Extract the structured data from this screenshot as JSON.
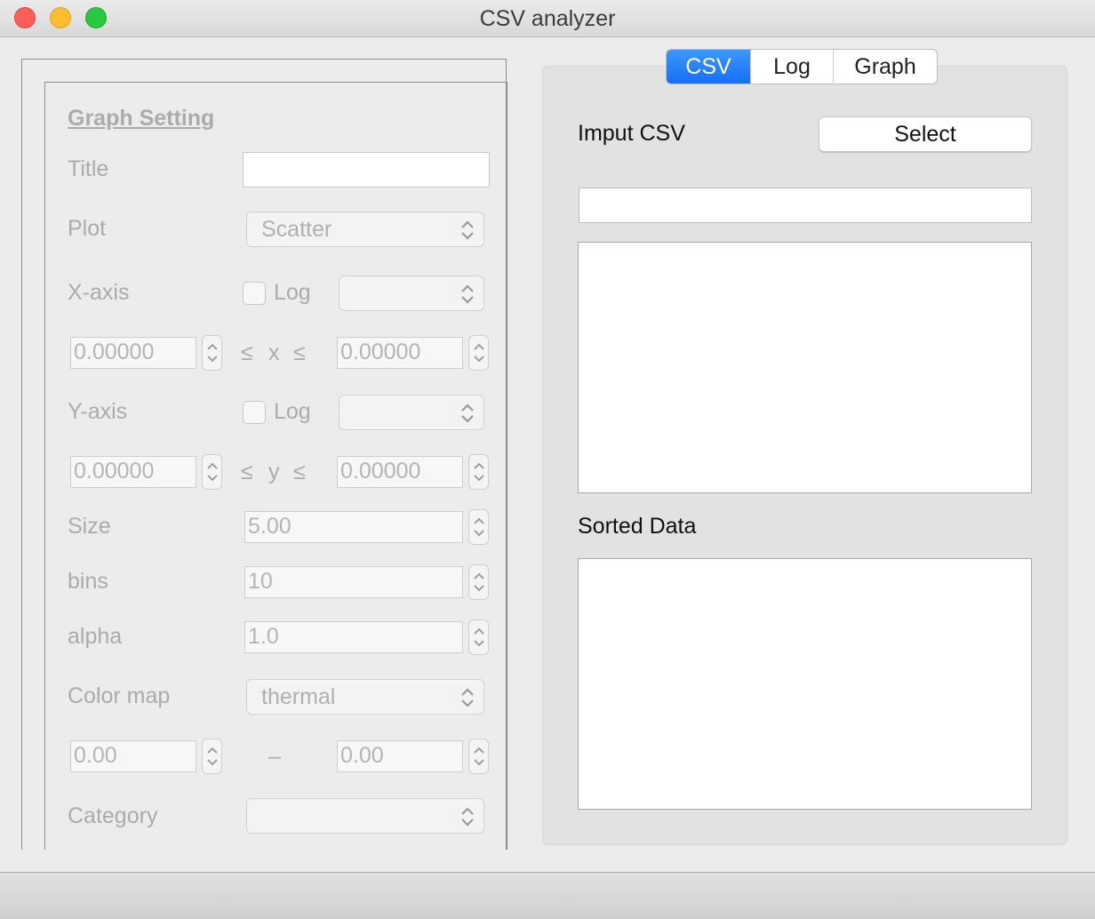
{
  "window": {
    "title": "CSV analyzer"
  },
  "settings": {
    "heading": "Graph Setting",
    "title_label": "Title",
    "title_value": "",
    "plot_label": "Plot",
    "plot_value": "Scatter",
    "xaxis_label": "X-axis",
    "xaxis_log": "Log",
    "x_min": "0.00000",
    "x_max": "0.00000",
    "x_ineq_left": "≤",
    "x_var": "x",
    "x_ineq_right": "≤",
    "yaxis_label": "Y-axis",
    "yaxis_log": "Log",
    "y_min": "0.00000",
    "y_max": "0.00000",
    "y_ineq_left": "≤",
    "y_var": "y",
    "y_ineq_right": "≤",
    "size_label": "Size",
    "size_value": "5.00",
    "bins_label": "bins",
    "bins_value": "10",
    "alpha_label": "alpha",
    "alpha_value": "1.0",
    "colormap_label": "Color map",
    "colormap_value": "thermal",
    "cmap_min": "0.00",
    "cmap_dash": "–",
    "cmap_max": "0.00",
    "category_label": "Category",
    "category_value": ""
  },
  "tabs": [
    "CSV",
    "Log",
    "Graph"
  ],
  "active_tab": "CSV",
  "csv": {
    "input_label": "Imput CSV",
    "select_button": "Select",
    "path_value": "",
    "sorted_label": "Sorted Data"
  }
}
